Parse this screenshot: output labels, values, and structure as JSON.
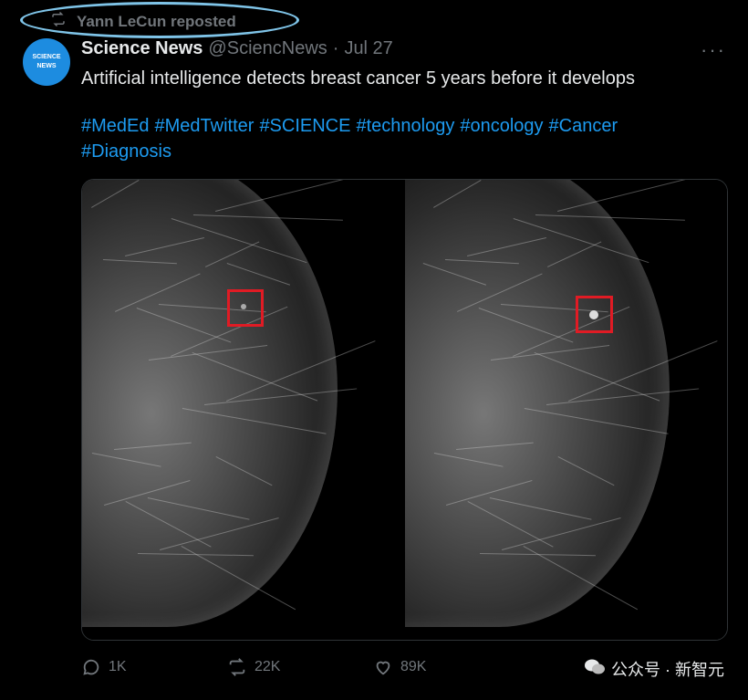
{
  "repost": {
    "label": "Yann LeCun reposted"
  },
  "author": {
    "avatar_text_line1": "SCIENCE",
    "avatar_text_line2": "NEWS",
    "name": "Science News",
    "handle": "@SciencNews",
    "separator": "·",
    "date": "Jul 27"
  },
  "tweet": {
    "text": "Artificial intelligence detects breast cancer 5 years before it develops",
    "hashtags": [
      "#MedEd",
      "#MedTwitter",
      "#SCIENCE",
      "#technology",
      "#oncology",
      "#Cancer",
      "#Diagnosis"
    ]
  },
  "actions": {
    "replies": "1K",
    "reposts": "22K",
    "likes": "89K"
  },
  "watermark": {
    "text": "公众号 · 新智元"
  },
  "colors": {
    "link": "#1d9bf0",
    "muted": "#71767b",
    "highlight_box": "#e01b24",
    "repost_circle": "#7fc4e8"
  }
}
